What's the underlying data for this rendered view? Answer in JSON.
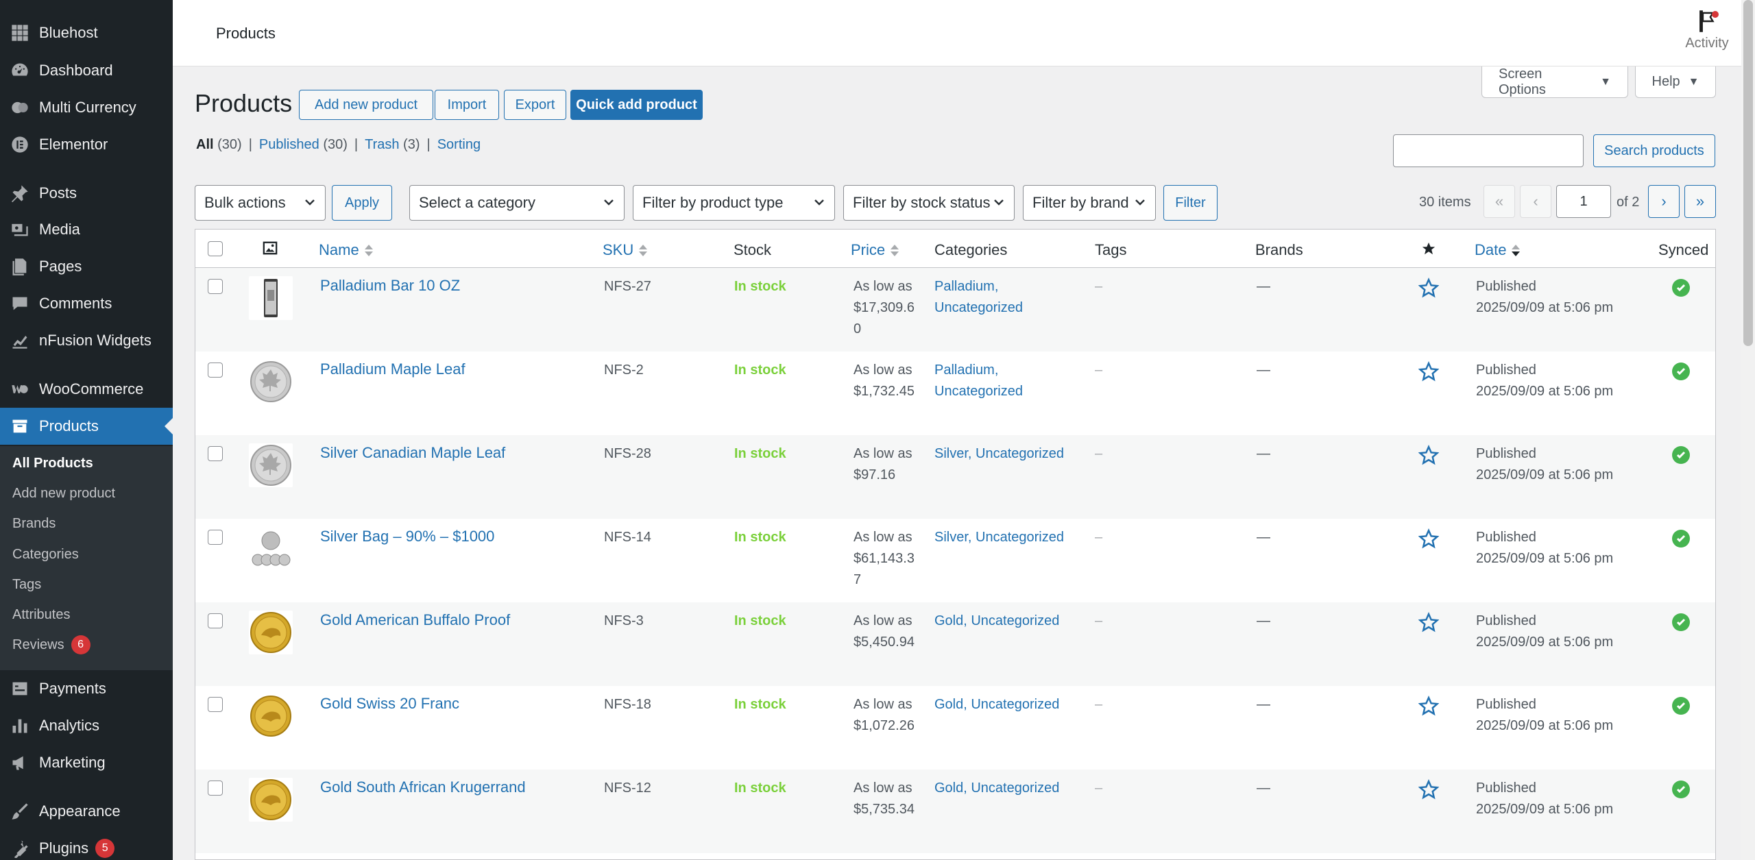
{
  "sidebar": {
    "items": [
      {
        "label": "Bluehost",
        "icon": "grid-icon"
      },
      {
        "label": "Dashboard",
        "icon": "dashboard-icon"
      },
      {
        "label": "Multi Currency",
        "icon": "currency-icon"
      },
      {
        "label": "Elementor",
        "icon": "elementor-icon"
      },
      {
        "label": "Posts",
        "icon": "pin-icon"
      },
      {
        "label": "Media",
        "icon": "media-icon"
      },
      {
        "label": "Pages",
        "icon": "pages-icon"
      },
      {
        "label": "Comments",
        "icon": "comments-icon"
      },
      {
        "label": "nFusion Widgets",
        "icon": "chart-icon"
      },
      {
        "label": "WooCommerce",
        "icon": "woocommerce-icon"
      },
      {
        "label": "Products",
        "icon": "archive-icon"
      },
      {
        "label": "Payments",
        "icon": "payments-icon"
      },
      {
        "label": "Analytics",
        "icon": "bar-chart-icon"
      },
      {
        "label": "Marketing",
        "icon": "megaphone-icon"
      },
      {
        "label": "Appearance",
        "icon": "brush-icon"
      },
      {
        "label": "Plugins",
        "icon": "plug-icon",
        "badge": "5"
      }
    ],
    "submenu": [
      {
        "label": "All Products"
      },
      {
        "label": "Add new product"
      },
      {
        "label": "Brands"
      },
      {
        "label": "Categories"
      },
      {
        "label": "Tags"
      },
      {
        "label": "Attributes"
      },
      {
        "label": "Reviews",
        "badge": "6"
      }
    ]
  },
  "header": {
    "title": "Products",
    "activity_label": "Activity"
  },
  "screen_options": {
    "label": "Screen Options",
    "help": "Help"
  },
  "page": {
    "title": "Products",
    "actions": [
      "Add new product",
      "Import",
      "Export",
      "Quick add product"
    ]
  },
  "views": {
    "all": {
      "label": "All",
      "count": "(30)"
    },
    "published": {
      "label": "Published",
      "count": "(30)"
    },
    "trash": {
      "label": "Trash",
      "count": "(3)"
    },
    "sorting": {
      "label": "Sorting"
    },
    "sep": "|"
  },
  "search": {
    "value": "",
    "button": "Search products"
  },
  "filters": {
    "bulk_actions": "Bulk actions",
    "apply": "Apply",
    "category": "Select a category",
    "product_type": "Filter by product type",
    "stock_status": "Filter by stock status",
    "brand": "Filter by brand",
    "filter": "Filter"
  },
  "pagination": {
    "items": "30 items",
    "first": "«",
    "prev": "‹",
    "current": "1",
    "of": "of 2",
    "next": "›",
    "last": "»"
  },
  "table": {
    "columns": {
      "name": "Name",
      "sku": "SKU",
      "stock": "Stock",
      "price": "Price",
      "categories": "Categories",
      "tags": "Tags",
      "brands": "Brands",
      "date": "Date",
      "synced": "Synced"
    },
    "rows": [
      {
        "name": "Palladium Bar 10 OZ",
        "thumb": "bar",
        "sku": "NFS-27",
        "stock": "In stock",
        "price": "As low as $17,309.60",
        "cat1": "Palladium,",
        "cat2": "Uncategorized",
        "tags": "–",
        "brands": "—",
        "date1": "Published",
        "date2": "2025/09/09 at 5:06 pm"
      },
      {
        "name": "Palladium Maple Leaf",
        "thumb": "silver",
        "sku": "NFS-2",
        "stock": "In stock",
        "price": "As low as $1,732.45",
        "cat1": "Palladium,",
        "cat2": "Uncategorized",
        "tags": "–",
        "brands": "—",
        "date1": "Published",
        "date2": "2025/09/09 at 5:06 pm"
      },
      {
        "name": "Silver Canadian Maple Leaf",
        "thumb": "silver",
        "sku": "NFS-28",
        "stock": "In stock",
        "price": "As low as $97.16",
        "cat1": "Silver, Uncategorized",
        "cat2": "",
        "tags": "–",
        "brands": "—",
        "date1": "Published",
        "date2": "2025/09/09 at 5:06 pm"
      },
      {
        "name": "Silver Bag – 90% – $1000",
        "thumb": "coins",
        "sku": "NFS-14",
        "stock": "In stock",
        "price": "As low as $61,143.37",
        "cat1": "Silver, Uncategorized",
        "cat2": "",
        "tags": "–",
        "brands": "—",
        "date1": "Published",
        "date2": "2025/09/09 at 5:06 pm"
      },
      {
        "name": "Gold American Buffalo Proof",
        "thumb": "gold",
        "sku": "NFS-3",
        "stock": "In stock",
        "price": "As low as $5,450.94",
        "cat1": "Gold, Uncategorized",
        "cat2": "",
        "tags": "–",
        "brands": "—",
        "date1": "Published",
        "date2": "2025/09/09 at 5:06 pm"
      },
      {
        "name": "Gold Swiss 20 Franc",
        "thumb": "gold",
        "sku": "NFS-18",
        "stock": "In stock",
        "price": "As low as $1,072.26",
        "cat1": "Gold, Uncategorized",
        "cat2": "",
        "tags": "–",
        "brands": "—",
        "date1": "Published",
        "date2": "2025/09/09 at 5:06 pm"
      },
      {
        "name": "Gold South African Krugerrand",
        "thumb": "gold",
        "sku": "NFS-12",
        "stock": "In stock",
        "price": "As low as $5,735.34",
        "cat1": "Gold, Uncategorized",
        "cat2": "",
        "tags": "–",
        "brands": "—",
        "date1": "Published",
        "date2": "2025/09/09 at 5:06 pm"
      }
    ]
  },
  "colors": {
    "accent": "#2271b1",
    "sidebar": "#1d2327",
    "in_stock": "#7ad03a",
    "synced": "#46b450",
    "badge": "#d63638"
  }
}
